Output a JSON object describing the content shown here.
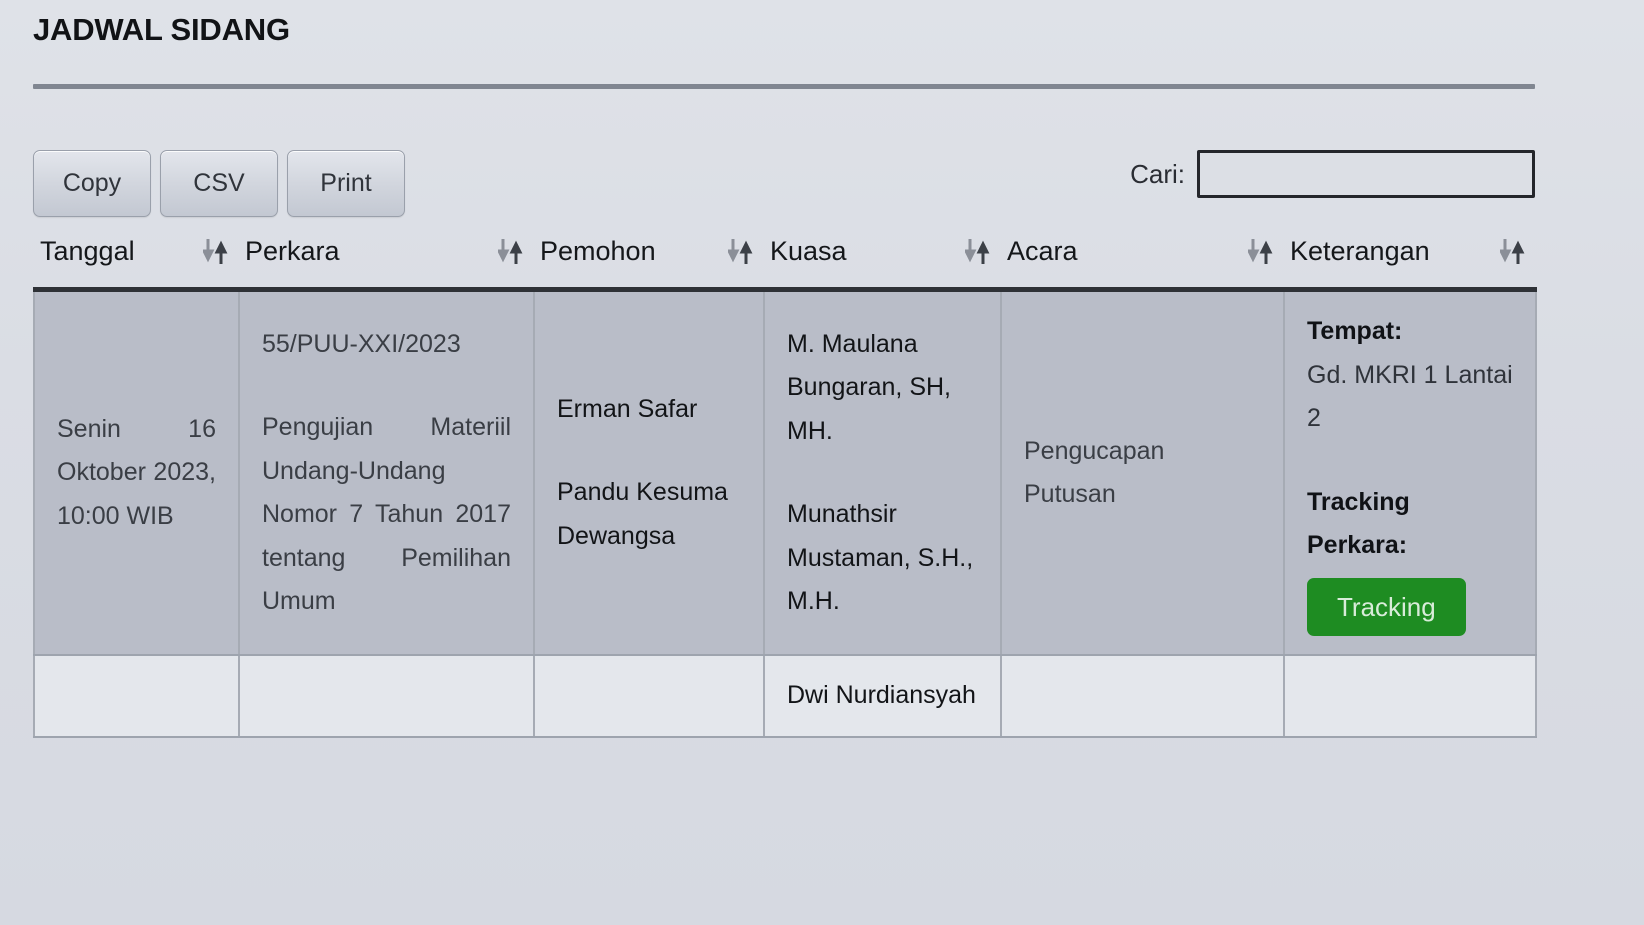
{
  "page": {
    "title": "JADWAL SIDANG"
  },
  "toolbar": {
    "buttons": [
      {
        "label": "Copy",
        "name": "copy-button"
      },
      {
        "label": "CSV",
        "name": "csv-button"
      },
      {
        "label": "Print",
        "name": "print-button"
      }
    ]
  },
  "search": {
    "label": "Cari:",
    "value": "",
    "placeholder": ""
  },
  "table": {
    "columns": [
      {
        "label": "Tanggal",
        "sort_icon": "sort-updown-icon"
      },
      {
        "label": "Perkara",
        "sort_icon": "sort-updown-icon"
      },
      {
        "label": "Pemohon",
        "sort_icon": "sort-updown-icon"
      },
      {
        "label": "Kuasa",
        "sort_icon": "sort-updown-icon"
      },
      {
        "label": "Acara",
        "sort_icon": "sort-updown-icon"
      },
      {
        "label": "Keterangan",
        "sort_icon": "sort-updown-icon"
      }
    ],
    "rows": [
      {
        "tanggal": "Senin 16 Oktober 2023, 10:00 WIB",
        "perkara_nomor": "55/PUU-XXI/2023",
        "perkara_judul": "Pengujian Materiil Undang-Undang Nomor 7 Tahun 2017 tentang Pemilihan Umum",
        "pemohon_1": "Erman Safar",
        "pemohon_2": "Pandu Kesuma Dewangsa",
        "kuasa_1": "M. Maulana Bungaran, SH, MH.",
        "kuasa_2": "Munathsir Mustaman, S.H., M.H.",
        "acara": "Pengucapan Putusan",
        "tempat_label": "Tempat:",
        "tempat_value": "Gd. MKRI 1 Lantai 2",
        "tracking_label": "Tracking Perkara:",
        "tracking_button": "Tracking"
      },
      {
        "tanggal": "",
        "perkara_nomor": "",
        "perkara_judul": "",
        "pemohon_1": "",
        "pemohon_2": "",
        "kuasa_1": "Dwi Nurdiansyah",
        "kuasa_2": "",
        "acara": "",
        "tempat_label": "",
        "tempat_value": "",
        "tracking_label": "",
        "tracking_button": ""
      }
    ]
  },
  "colors": {
    "accent_green": "#1e8c22",
    "row_odd_bg": "#b9bdc8",
    "row_even_bg": "#e4e7ec",
    "page_bg": "#dadde4",
    "header_rule": "#2e3136"
  }
}
